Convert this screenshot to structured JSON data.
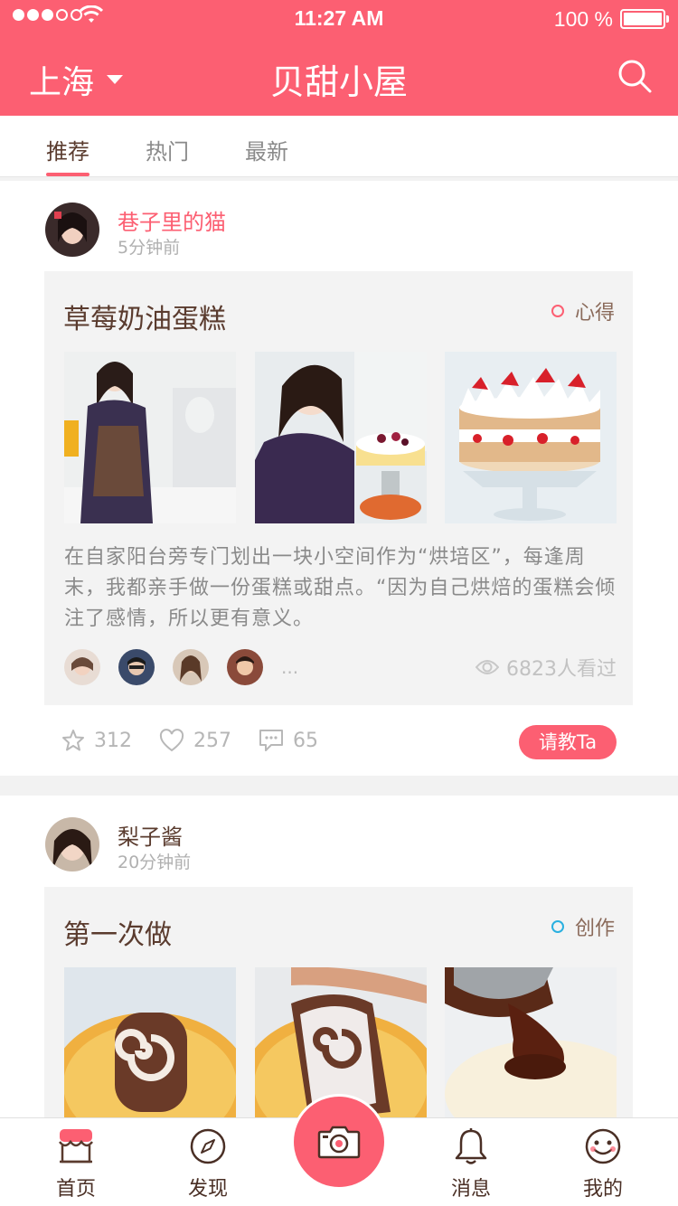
{
  "status": {
    "time": "11:27 AM",
    "battery": "100 %"
  },
  "header": {
    "city": "上海",
    "title": "贝甜小屋"
  },
  "tabs": [
    "推荐",
    "热门",
    "最新"
  ],
  "posts": [
    {
      "author": "巷子里的猫",
      "time": "5分钟前",
      "title": "草莓奶油蛋糕",
      "tag": "心得",
      "desc": "在自家阳台旁专门划出一块小空间作为“烘培区”，每逢周末，我都亲手做一份蛋糕或甜点。“因为自己烘焙的蛋糕会倾注了感情，所以更有意义。",
      "more": "...",
      "views": "6823人看过",
      "stars": "312",
      "likes": "257",
      "comments": "65",
      "ask": "请教Ta"
    },
    {
      "author": "梨子酱",
      "time": "20分钟前",
      "title": "第一次做",
      "tag": "创作"
    }
  ],
  "nav": {
    "home": "首页",
    "discover": "发现",
    "messages": "消息",
    "mine": "我的"
  },
  "colors": {
    "accent": "#fc5f72",
    "brown": "#5a3b2e",
    "blue_tag": "#2ab0e0"
  }
}
